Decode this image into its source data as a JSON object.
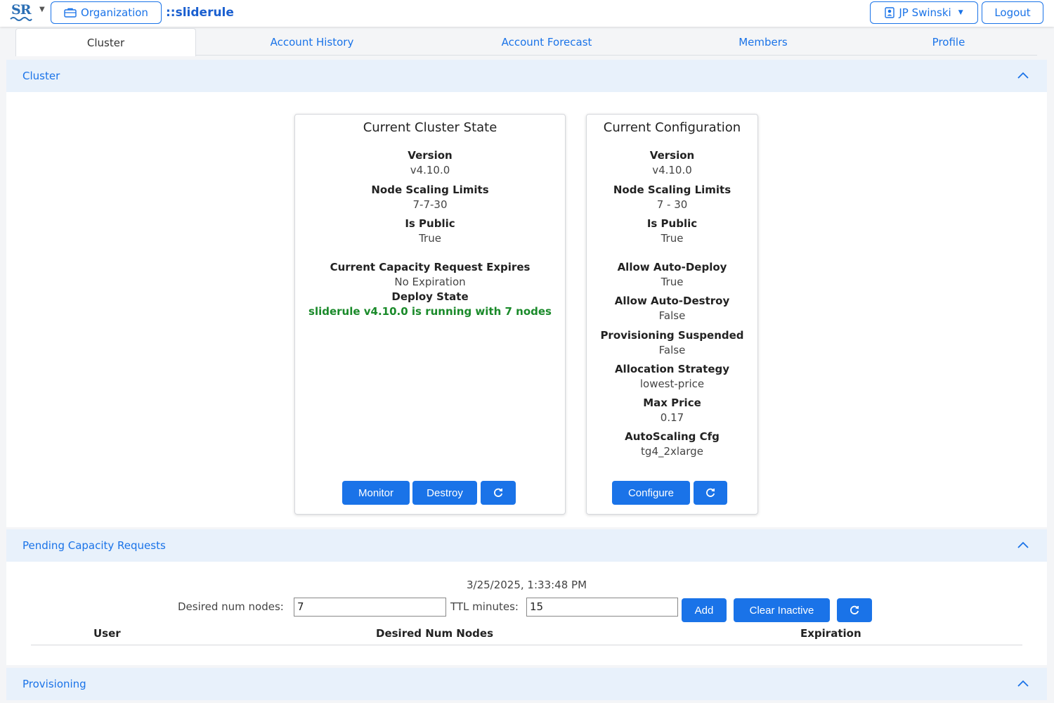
{
  "app": {
    "logo_text": "SR",
    "org_button": "Organization",
    "org_name": "::sliderule",
    "user_button": "JP Swinski",
    "logout_button": "Logout"
  },
  "tabs": [
    {
      "label": "Cluster",
      "active": true
    },
    {
      "label": "Account History",
      "active": false
    },
    {
      "label": "Account Forecast",
      "active": false
    },
    {
      "label": "Members",
      "active": false
    },
    {
      "label": "Profile",
      "active": false
    }
  ],
  "cluster_panel": {
    "title": "Cluster",
    "state_card": {
      "title": "Current Cluster State",
      "version_label": "Version",
      "version_value": "v4.10.0",
      "scaling_label": "Node Scaling Limits",
      "scaling_value": "7-7-30",
      "public_label": "Is Public",
      "public_value": "True",
      "expires_label": "Current Capacity Request Expires",
      "expires_value": "No Expiration",
      "deploy_label": "Deploy State",
      "deploy_value": "sliderule v4.10.0 is running with 7 nodes",
      "monitor_button": "Monitor",
      "destroy_button": "Destroy"
    },
    "config_card": {
      "title": "Current Configuration",
      "version_label": "Version",
      "version_value": "v4.10.0",
      "scaling_label": "Node Scaling Limits",
      "scaling_value": "7 - 30",
      "public_label": "Is Public",
      "public_value": "True",
      "auto_deploy_label": "Allow Auto-Deploy",
      "auto_deploy_value": "True",
      "auto_destroy_label": "Allow Auto-Destroy",
      "auto_destroy_value": "False",
      "suspended_label": "Provisioning Suspended",
      "suspended_value": "False",
      "strategy_label": "Allocation Strategy",
      "strategy_value": "lowest-price",
      "max_price_label": "Max Price",
      "max_price_value": "0.17",
      "autoscaling_label": "AutoScaling Cfg",
      "autoscaling_value": "tg4_2xlarge",
      "configure_button": "Configure"
    }
  },
  "pending_panel": {
    "title": "Pending Capacity Requests",
    "timestamp": "3/25/2025, 1:33:48 PM",
    "nodes_label": "Desired num nodes:",
    "nodes_value": "7",
    "ttl_label": "TTL minutes:",
    "ttl_value": "15",
    "add_button": "Add",
    "clear_button": "Clear Inactive",
    "columns": [
      "User",
      "Desired Num Nodes",
      "Expiration"
    ]
  },
  "provisioning_panel": {
    "title": "Provisioning"
  },
  "colors": {
    "accent": "#1a73e8",
    "panel_header": "#e8f1fb",
    "success": "#1a8a2a"
  }
}
